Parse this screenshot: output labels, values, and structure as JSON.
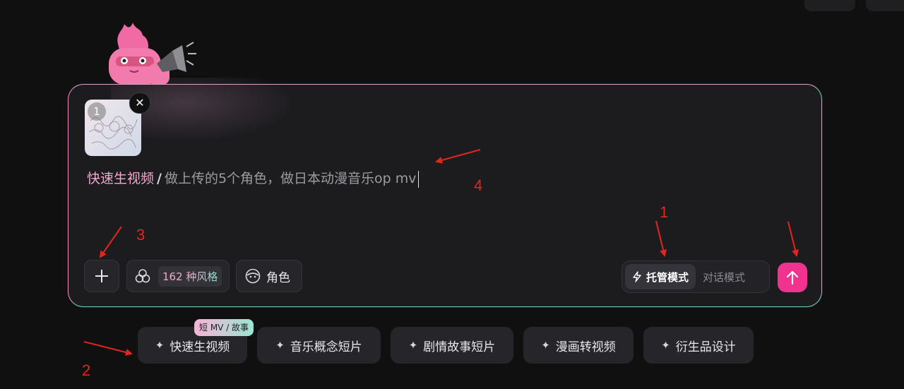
{
  "composer": {
    "attachment_index": "1",
    "mode_tag": "快速生视频",
    "slash": "/",
    "prompt_text": "做上传的5个角色，做日本动漫音乐op mv"
  },
  "toolbar": {
    "styles_count": "162",
    "styles_label": "种风格",
    "role_label": "角色"
  },
  "mode_switch": {
    "active_label": "托管模式",
    "inactive_label": "对话模式"
  },
  "presets": [
    {
      "label": "快速生视频"
    },
    {
      "label": "音乐概念短片"
    },
    {
      "label": "剧情故事短片"
    },
    {
      "label": "漫画转视频"
    },
    {
      "label": "衍生品设计"
    }
  ],
  "preset_badge": "短 MV / 故事",
  "annotations": [
    "1",
    "2",
    "3",
    "4"
  ],
  "colors": {
    "accent_pink": "#f0338f",
    "annotation_red": "#e3261d",
    "border_teal": "#6fd3b9",
    "tag_pink": "#f3a9cf"
  }
}
